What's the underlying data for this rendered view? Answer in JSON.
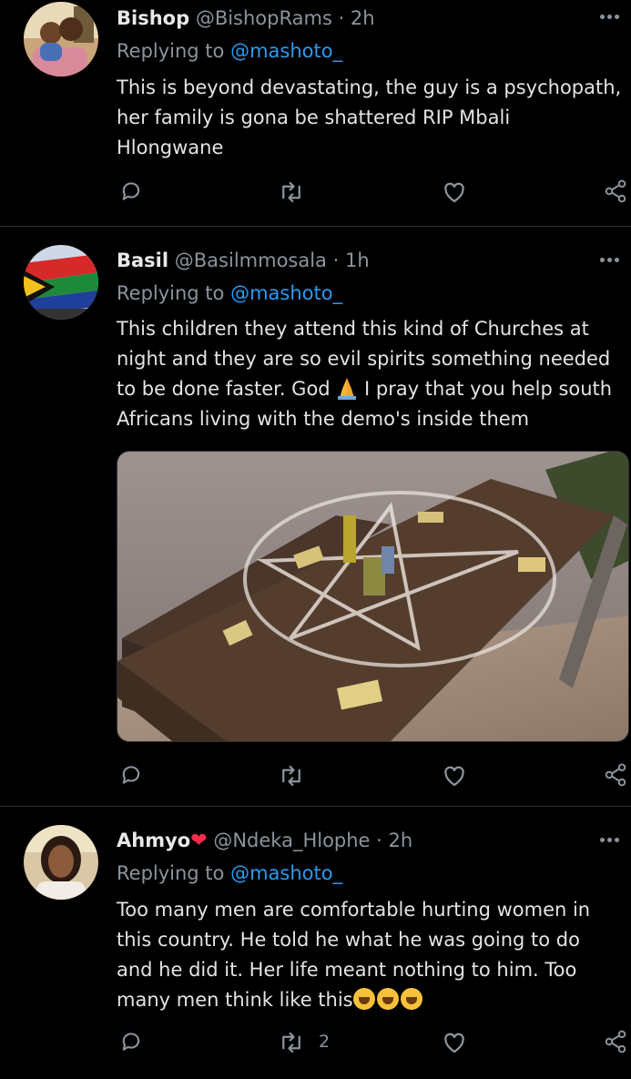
{
  "tweets": [
    {
      "name": "Bishop",
      "handle": "@BishopRams",
      "time": "· 2h",
      "replying_prefix": "Replying to ",
      "replying_to": "@mashoto_",
      "lines": [
        "This is beyond devastating, the guy is a psychopath,",
        "her family is gona be shattered RIP Mbali",
        "Hlongwane"
      ]
    },
    {
      "name": "Basil",
      "handle": "@Basilmmosala",
      "time": "· 1h",
      "replying_prefix": "Replying to ",
      "replying_to": "@mashoto_",
      "lines": [
        "This children they attend this kind of Churches at",
        "night and they are so evil spirits something needed",
        "to be done faster. God",
        " I pray that you help south",
        "Africans living with the demo's inside them"
      ]
    },
    {
      "name": "Ahmyo",
      "handle": "@Ndeka_Hlophe",
      "time": "· 2h",
      "replying_prefix": "Replying to ",
      "replying_to": "@mashoto_",
      "lines": [
        "Too many men are comfortable hurting women in",
        "this country. He told he what he was going to do",
        "and he did it. Her life meant nothing to him. Too",
        "many men think like this"
      ],
      "retweet_count": "2"
    }
  ],
  "icons": {
    "reply": "reply-icon",
    "retweet": "retweet-icon",
    "like": "like-icon",
    "share": "share-icon",
    "more": "more-icon",
    "heart_emoji": "red-heart-emoji",
    "pray_emoji": "folded-hands-emoji",
    "crying_emoji": "loudly-crying-face-emoji"
  },
  "colors": {
    "background": "#000000",
    "mention": "#2a9bf0",
    "secondary_text": "#8b949c",
    "divider": "#2f3336"
  }
}
